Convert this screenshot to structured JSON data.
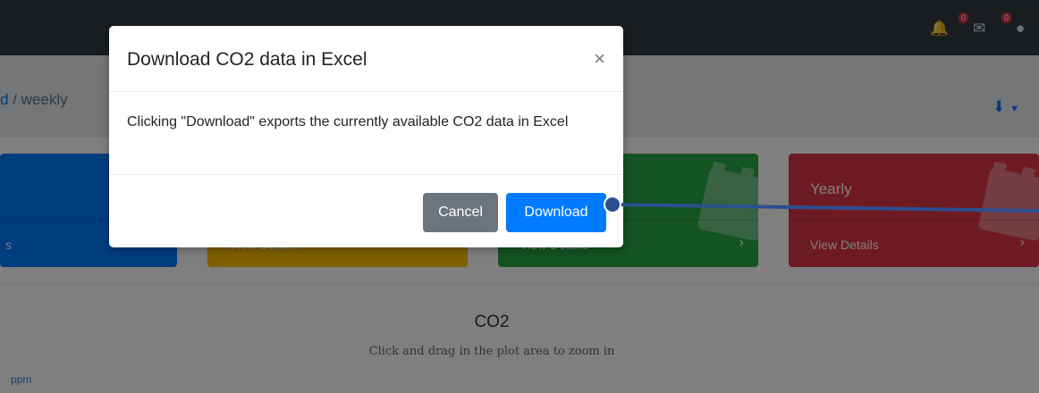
{
  "topbar": {
    "bell_badge": "0",
    "mail_badge": "0"
  },
  "breadcrumb": {
    "link": "d",
    "separator": " / ",
    "current": "weekly"
  },
  "cards": [
    {
      "title": "",
      "footer": "s",
      "color": "#007bff"
    },
    {
      "title": "",
      "footer": "View Details",
      "color": "#ffc107"
    },
    {
      "title": "",
      "footer": "View Details",
      "color": "#28a745"
    },
    {
      "title": "Yearly",
      "footer": "View Details",
      "color": "#dc3545"
    }
  ],
  "chart": {
    "title": "CO2",
    "subtitle": "Click and drag in the plot area to zoom in",
    "unit": "ppm"
  },
  "modal": {
    "title": "Download CO2 data in Excel",
    "close": "×",
    "body": "Clicking \"Download\" exports the currently available CO2 data in Excel",
    "cancel_label": "Cancel",
    "download_label": "Download"
  },
  "colors": {
    "topbar": "#343a40",
    "primary": "#007bff",
    "secondary": "#6c757d",
    "pointer": "#2c4f8f"
  }
}
